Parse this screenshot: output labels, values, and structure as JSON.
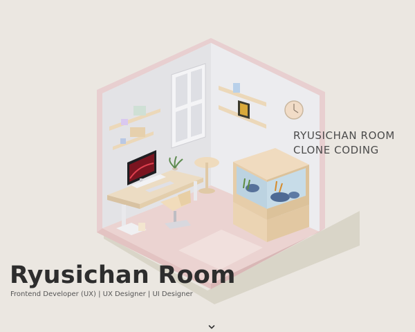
{
  "side_caption": {
    "line1": "RYUSICHAN ROOM",
    "line2": "CLONE CODING"
  },
  "hero": {
    "title": "Ryusichan Room",
    "subtitle": "Frontend Developer (UX) | UX Designer | UI Designer"
  },
  "icons": {
    "scroll": "chevron-down-icon"
  },
  "colors": {
    "background": "#ebe7e1",
    "wall_left": "#e4e4e6",
    "wall_right": "#ececee",
    "floor": "#ecd4d2",
    "wall_trim": "#e7cfd0",
    "wood": "#efd9b8",
    "aquarium_water": "#c3d6e2",
    "text_dark": "#2d2d2d"
  }
}
